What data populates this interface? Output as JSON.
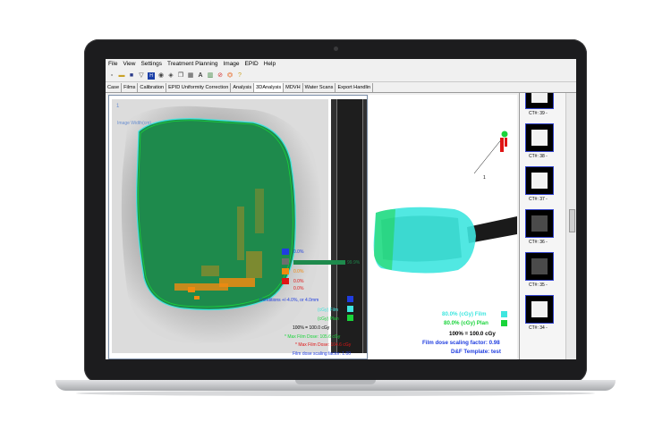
{
  "menu": [
    "File",
    "View",
    "Settings",
    "Treatment Planning",
    "Image",
    "EPID",
    "Help"
  ],
  "tabs": [
    {
      "label": "Case"
    },
    {
      "label": "Films"
    },
    {
      "label": "Calibration"
    },
    {
      "label": "EPID Uniformity Correction"
    },
    {
      "label": "Analysis"
    },
    {
      "label": "3DAnalysis",
      "active": true
    },
    {
      "label": "MDVH"
    },
    {
      "label": "Water Scans"
    },
    {
      "label": "Export Handlin"
    }
  ],
  "left_overlay": {
    "corner_label": "1",
    "image_line": "Image Width(cm)",
    "legend_values": [
      "0.0%",
      "0.0%",
      "0.0%",
      "0.0%"
    ],
    "bar_value": "99.9%",
    "conditions": "Conditions +/-4.0%, or 4.0mm",
    "film_label": "(cGy) Film",
    "plan_label": "(cGy) Plan",
    "scale_label": "100% = 100.0 cGy",
    "max_film": "* Max Film Dose: 105.6 cGy",
    "max_film_red": "* Max Film Dose: 104.6 cGy",
    "film_dose_scaling": "Film dose scaling factor: 1.00"
  },
  "right_overlay": {
    "film_line": "80.0% (cGy) Film",
    "plan_line": "80.0% (cGy) Plan",
    "scale_line": "100% = 100.0 cGy",
    "scaling_line": "Film dose scaling factor: 0.98",
    "template_line": "D&F Template: test",
    "pointer_label": "1"
  },
  "thumbnails": [
    "CT#: 39 -",
    "CT#: 38 -",
    "CT#: 37 -",
    "CT#: 36 -",
    "CT#: 35 -",
    "CT#: 34 -"
  ],
  "colors": {
    "accent_green": "#1e8a4c",
    "swatch_blue": "#1f3de0",
    "swatch_gray": "#6e6e6e",
    "swatch_orange": "#f08a10",
    "swatch_red": "#e01515",
    "film_cyan": "#3ee6df",
    "plan_green": "#19d43a"
  }
}
